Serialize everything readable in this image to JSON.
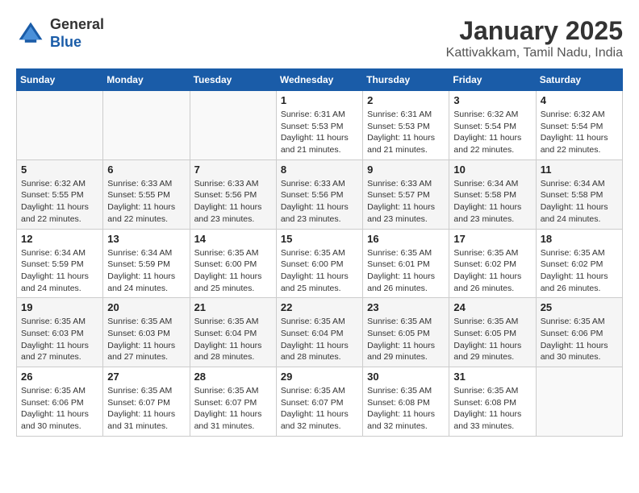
{
  "header": {
    "logo_line1": "General",
    "logo_line2": "Blue",
    "title": "January 2025",
    "subtitle": "Kattivakkam, Tamil Nadu, India"
  },
  "weekdays": [
    "Sunday",
    "Monday",
    "Tuesday",
    "Wednesday",
    "Thursday",
    "Friday",
    "Saturday"
  ],
  "weeks": [
    [
      {
        "day": "",
        "info": ""
      },
      {
        "day": "",
        "info": ""
      },
      {
        "day": "",
        "info": ""
      },
      {
        "day": "1",
        "info": "Sunrise: 6:31 AM\nSunset: 5:53 PM\nDaylight: 11 hours\nand 21 minutes."
      },
      {
        "day": "2",
        "info": "Sunrise: 6:31 AM\nSunset: 5:53 PM\nDaylight: 11 hours\nand 21 minutes."
      },
      {
        "day": "3",
        "info": "Sunrise: 6:32 AM\nSunset: 5:54 PM\nDaylight: 11 hours\nand 22 minutes."
      },
      {
        "day": "4",
        "info": "Sunrise: 6:32 AM\nSunset: 5:54 PM\nDaylight: 11 hours\nand 22 minutes."
      }
    ],
    [
      {
        "day": "5",
        "info": "Sunrise: 6:32 AM\nSunset: 5:55 PM\nDaylight: 11 hours\nand 22 minutes."
      },
      {
        "day": "6",
        "info": "Sunrise: 6:33 AM\nSunset: 5:55 PM\nDaylight: 11 hours\nand 22 minutes."
      },
      {
        "day": "7",
        "info": "Sunrise: 6:33 AM\nSunset: 5:56 PM\nDaylight: 11 hours\nand 23 minutes."
      },
      {
        "day": "8",
        "info": "Sunrise: 6:33 AM\nSunset: 5:56 PM\nDaylight: 11 hours\nand 23 minutes."
      },
      {
        "day": "9",
        "info": "Sunrise: 6:33 AM\nSunset: 5:57 PM\nDaylight: 11 hours\nand 23 minutes."
      },
      {
        "day": "10",
        "info": "Sunrise: 6:34 AM\nSunset: 5:58 PM\nDaylight: 11 hours\nand 23 minutes."
      },
      {
        "day": "11",
        "info": "Sunrise: 6:34 AM\nSunset: 5:58 PM\nDaylight: 11 hours\nand 24 minutes."
      }
    ],
    [
      {
        "day": "12",
        "info": "Sunrise: 6:34 AM\nSunset: 5:59 PM\nDaylight: 11 hours\nand 24 minutes."
      },
      {
        "day": "13",
        "info": "Sunrise: 6:34 AM\nSunset: 5:59 PM\nDaylight: 11 hours\nand 24 minutes."
      },
      {
        "day": "14",
        "info": "Sunrise: 6:35 AM\nSunset: 6:00 PM\nDaylight: 11 hours\nand 25 minutes."
      },
      {
        "day": "15",
        "info": "Sunrise: 6:35 AM\nSunset: 6:00 PM\nDaylight: 11 hours\nand 25 minutes."
      },
      {
        "day": "16",
        "info": "Sunrise: 6:35 AM\nSunset: 6:01 PM\nDaylight: 11 hours\nand 26 minutes."
      },
      {
        "day": "17",
        "info": "Sunrise: 6:35 AM\nSunset: 6:02 PM\nDaylight: 11 hours\nand 26 minutes."
      },
      {
        "day": "18",
        "info": "Sunrise: 6:35 AM\nSunset: 6:02 PM\nDaylight: 11 hours\nand 26 minutes."
      }
    ],
    [
      {
        "day": "19",
        "info": "Sunrise: 6:35 AM\nSunset: 6:03 PM\nDaylight: 11 hours\nand 27 minutes."
      },
      {
        "day": "20",
        "info": "Sunrise: 6:35 AM\nSunset: 6:03 PM\nDaylight: 11 hours\nand 27 minutes."
      },
      {
        "day": "21",
        "info": "Sunrise: 6:35 AM\nSunset: 6:04 PM\nDaylight: 11 hours\nand 28 minutes."
      },
      {
        "day": "22",
        "info": "Sunrise: 6:35 AM\nSunset: 6:04 PM\nDaylight: 11 hours\nand 28 minutes."
      },
      {
        "day": "23",
        "info": "Sunrise: 6:35 AM\nSunset: 6:05 PM\nDaylight: 11 hours\nand 29 minutes."
      },
      {
        "day": "24",
        "info": "Sunrise: 6:35 AM\nSunset: 6:05 PM\nDaylight: 11 hours\nand 29 minutes."
      },
      {
        "day": "25",
        "info": "Sunrise: 6:35 AM\nSunset: 6:06 PM\nDaylight: 11 hours\nand 30 minutes."
      }
    ],
    [
      {
        "day": "26",
        "info": "Sunrise: 6:35 AM\nSunset: 6:06 PM\nDaylight: 11 hours\nand 30 minutes."
      },
      {
        "day": "27",
        "info": "Sunrise: 6:35 AM\nSunset: 6:07 PM\nDaylight: 11 hours\nand 31 minutes."
      },
      {
        "day": "28",
        "info": "Sunrise: 6:35 AM\nSunset: 6:07 PM\nDaylight: 11 hours\nand 31 minutes."
      },
      {
        "day": "29",
        "info": "Sunrise: 6:35 AM\nSunset: 6:07 PM\nDaylight: 11 hours\nand 32 minutes."
      },
      {
        "day": "30",
        "info": "Sunrise: 6:35 AM\nSunset: 6:08 PM\nDaylight: 11 hours\nand 32 minutes."
      },
      {
        "day": "31",
        "info": "Sunrise: 6:35 AM\nSunset: 6:08 PM\nDaylight: 11 hours\nand 33 minutes."
      },
      {
        "day": "",
        "info": ""
      }
    ]
  ]
}
